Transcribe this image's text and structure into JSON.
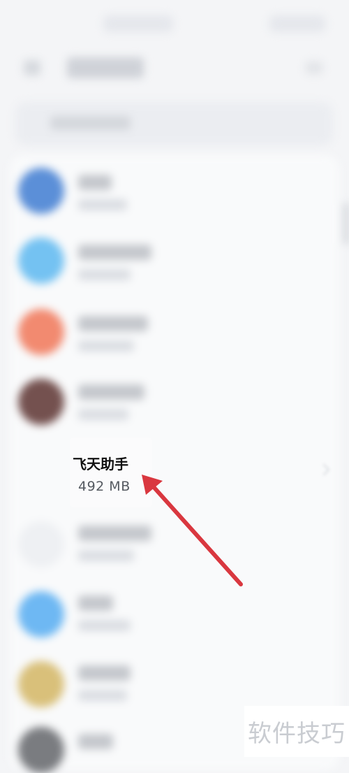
{
  "app_item": {
    "name": "飞天助手",
    "size": "492 MB"
  },
  "icons": {
    "row_1": "blue-app-icon",
    "row_2": "light-blue-app-icon",
    "row_3": "orange-app-icon",
    "row_4": "dark-red-app-icon",
    "row_5": "white-app-icon",
    "row_6": "light-blue-app-icon",
    "row_7": "yellow-app-icon",
    "row_8": "grey-app-icon"
  },
  "annotation": {
    "arrow_color": "#d9373f",
    "arrow_target": "app-size-label"
  },
  "watermark": {
    "text": "软件技巧"
  },
  "colors": {
    "background": "#f4f5f7",
    "arrow": "#d9373f"
  }
}
